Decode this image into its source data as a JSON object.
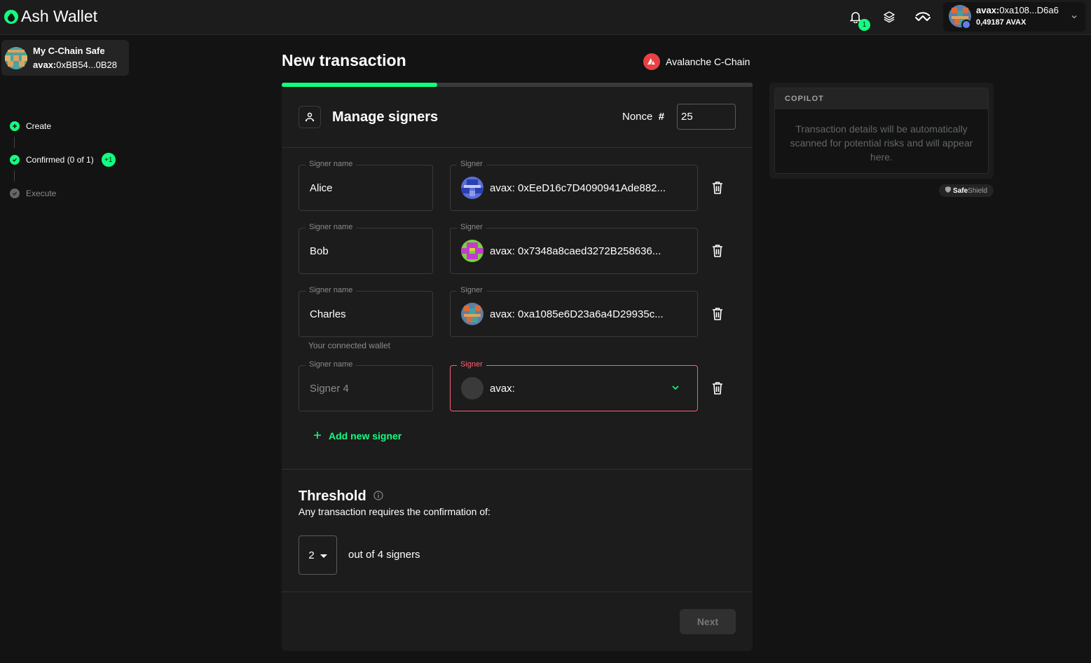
{
  "header": {
    "app_name": "Ash Wallet",
    "notification_count": "1",
    "account_address": "avax:0xa108...D6a6",
    "account_address_prefix": "avax:",
    "account_address_short": "0xa108...D6a6",
    "account_balance": "0,49187 AVAX"
  },
  "sidebar": {
    "safe_name": "My C-Chain Safe",
    "safe_address_prefix": "avax:",
    "safe_address_short": "0xBB54...0B28",
    "steps": [
      {
        "label": "Create",
        "status": "done"
      },
      {
        "label": "Confirmed (0 of 1)",
        "badge": "+1",
        "status": "done"
      },
      {
        "label": "Execute",
        "status": "pending"
      }
    ]
  },
  "main": {
    "title": "New transaction",
    "chain_name": "Avalanche C-Chain",
    "progress_fraction": 0.33,
    "section_title": "Manage signers",
    "nonce_label": "Nonce",
    "nonce_hash": "#",
    "nonce_value": "25",
    "signer_name_label": "Signer name",
    "signer_label": "Signer",
    "signers": [
      {
        "name": "Alice",
        "address": "avax: 0xEeD16c7D4090941Ade882..."
      },
      {
        "name": "Bob",
        "address": "avax: 0x7348a8caed3272B258636..."
      },
      {
        "name": "Charles",
        "address": "avax: 0xa1085e6D23a6a4D29935c...",
        "helper": "Your connected wallet"
      },
      {
        "name_placeholder": "Signer 4",
        "address": "avax:"
      }
    ],
    "add_signer_label": "Add new signer",
    "threshold_title": "Threshold",
    "threshold_desc": "Any transaction requires the confirmation of:",
    "threshold_value": "2",
    "threshold_out_of": "out of 4 signers",
    "next_label": "Next"
  },
  "copilot": {
    "title": "COPILOT",
    "text": "Transaction details will be automatically scanned for potential risks and will appear here.",
    "shield_brand_bold": "Safe",
    "shield_brand": "Shield"
  },
  "colors": {
    "accent": "#12ff80",
    "error": "#ff5f72",
    "background": "#121312",
    "panel": "#1c1c1c"
  },
  "icons": {
    "logo": "flame-logo-icon",
    "bell": "bell-icon",
    "layers": "layers-icon",
    "connect": "wallet-connect-icon",
    "trash": "trash-icon",
    "chevron": "chevron-down-icon",
    "info": "info-icon"
  }
}
